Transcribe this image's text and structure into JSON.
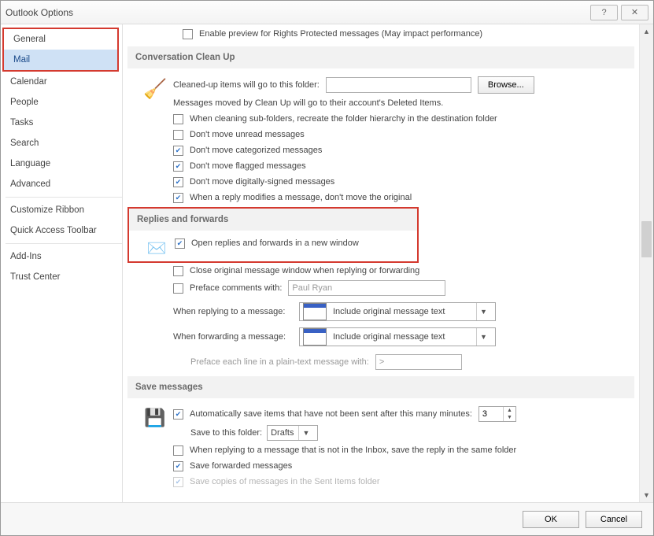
{
  "title": "Outlook Options",
  "titlebar": {
    "help": "?",
    "close": "✕"
  },
  "nav": {
    "general": "General",
    "mail": "Mail",
    "calendar": "Calendar",
    "people": "People",
    "tasks": "Tasks",
    "search": "Search",
    "language": "Language",
    "advanced": "Advanced",
    "customize_ribbon": "Customize Ribbon",
    "quick_access": "Quick Access Toolbar",
    "addins": "Add-Ins",
    "trust": "Trust Center"
  },
  "top_checkbox": "Enable preview for Rights Protected messages (May impact performance)",
  "cleanup": {
    "header": "Conversation Clean Up",
    "folder_label": "Cleaned-up items will go to this folder:",
    "browse": "Browse...",
    "note": "Messages moved by Clean Up will go to their account's Deleted Items.",
    "cb1": "When cleaning sub-folders, recreate the folder hierarchy in the destination folder",
    "cb2": "Don't move unread messages",
    "cb3": "Don't move categorized messages",
    "cb4": "Don't move flagged messages",
    "cb5": "Don't move digitally-signed messages",
    "cb6": "When a reply modifies a message, don't move the original"
  },
  "replies": {
    "header": "Replies and forwards",
    "open_new_window": "Open replies and forwards in a new window",
    "close_original": "Close original message window when replying or forwarding",
    "preface_with": "Preface comments with:",
    "preface_value": "Paul Ryan",
    "when_reply": "When replying to a message:",
    "when_forward": "When forwarding a message:",
    "include_text": "Include original message text",
    "preface_line": "Preface each line in a plain-text message with:",
    "preface_char": ">"
  },
  "save": {
    "header": "Save messages",
    "auto_save": "Automatically save items that have not been sent after this many minutes:",
    "minutes": "3",
    "save_folder_label": "Save to this folder:",
    "drafts": "Drafts",
    "same_folder": "When replying to a message that is not in the Inbox, save the reply in the same folder",
    "save_forwarded": "Save forwarded messages",
    "sent_items": "Save copies of messages in the Sent Items folder"
  },
  "footer": {
    "ok": "OK",
    "cancel": "Cancel"
  }
}
